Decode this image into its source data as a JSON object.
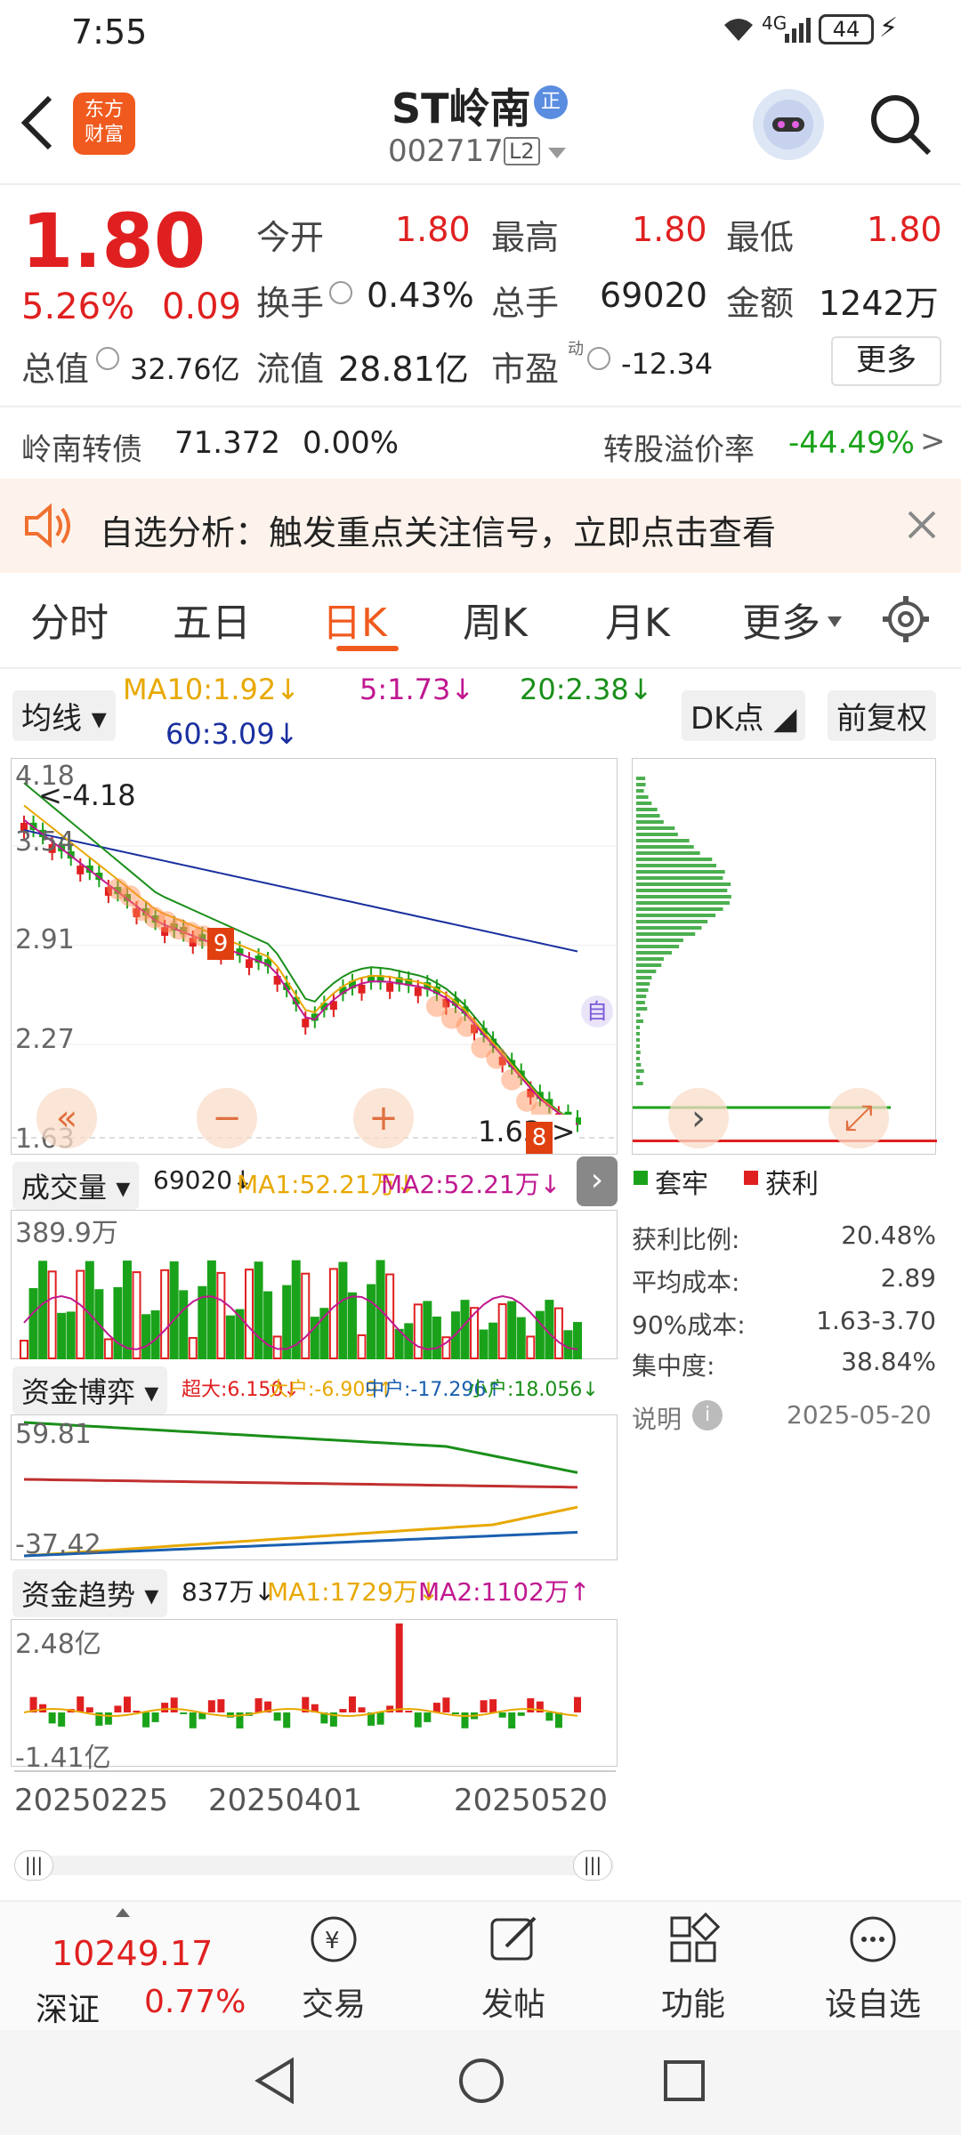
{
  "status": {
    "time": "7:55",
    "signal": "4G",
    "battery": "44"
  },
  "header": {
    "title": "ST岭南",
    "badge": "正",
    "code": "002717",
    "level": "L2",
    "logo_line1": "东方",
    "logo_line2": "财富"
  },
  "quote": {
    "price": "1.80",
    "pct": "5.26%",
    "chg": "0.09",
    "open_label": "今开",
    "open": "1.80",
    "high_label": "最高",
    "high": "1.80",
    "low_label": "最低",
    "low": "1.80",
    "turnover_label": "换手",
    "turnover": "0.43%",
    "vol_label": "总手",
    "vol": "69020",
    "amount_label": "金额",
    "amount": "1242万",
    "mcap_label": "总值",
    "mcap": "32.76亿",
    "float_label": "流值",
    "float": "28.81亿",
    "pe_label": "市盈",
    "pe_sup": "动",
    "pe": "-12.34",
    "more": "更多"
  },
  "bond": {
    "name": "岭南转债",
    "price": "71.372",
    "chg": "0.00%",
    "premium_label": "转股溢价率",
    "premium": "-44.49%",
    "arrow": ">"
  },
  "notice": {
    "text": "自选分析：触发重点关注信号，立即点击查看"
  },
  "tabs": [
    "分时",
    "五日",
    "日K",
    "周K",
    "月K",
    "更多"
  ],
  "ma": {
    "select": "均线",
    "ma10": "MA10:1.92↓",
    "ma5": "5:1.73↓",
    "ma20": "20:2.38↓",
    "ma60": "60:3.09↓",
    "dk": "DK点",
    "adjust": "前复权"
  },
  "kchart": {
    "y_top": "4.18",
    "high_marker": "<-4.18",
    "y2": "3.54",
    "y3": "2.91",
    "y4": "2.27",
    "y_bottom": "1.63",
    "low_marker": "1.63->",
    "self_tag": "自",
    "signal_9": "9",
    "signal_8": "8"
  },
  "chip": {
    "legend_trapped": "套牢",
    "legend_profit": "获利",
    "rows": [
      {
        "k": "获利比例:",
        "v": "20.48%"
      },
      {
        "k": "平均成本:",
        "v": "2.89"
      },
      {
        "k": "90%成本:",
        "v": "1.63-3.70"
      },
      {
        "k": "集中度:",
        "v": "38.84%"
      }
    ],
    "note": "说明",
    "date": "2025-05-20"
  },
  "volume": {
    "select": "成交量",
    "value": "69020↓",
    "ma1": "MA1:52.21万↓",
    "ma2": "MA2:52.21万↓",
    "top": "389.9万"
  },
  "fund": {
    "select": "资金博弈",
    "super": "超大:6.150↓",
    "large": "大户:-6.909↑",
    "mid": "中户:-17.296↑",
    "small": "小户:18.056↓",
    "top": "59.81",
    "bottom": "-37.42"
  },
  "trend": {
    "select": "资金趋势",
    "value": "837万↓",
    "ma1": "MA1:1729万↓",
    "ma2": "MA2:1102万↑",
    "top": "2.48亿",
    "bottom": "-1.41亿"
  },
  "dates": [
    "20250225",
    "20250401",
    "20250520"
  ],
  "index": {
    "value": "10249.17",
    "name": "深证",
    "pct": "0.77%"
  },
  "bottom_nav": [
    {
      "icon": "trade-icon",
      "label": "交易"
    },
    {
      "icon": "post-icon",
      "label": "发帖"
    },
    {
      "icon": "grid-icon",
      "label": "功能"
    },
    {
      "icon": "more-icon",
      "label": "设自选"
    }
  ],
  "colors": {
    "up": "#e02020",
    "down": "#1aa31a",
    "ma5": "#c01890",
    "ma10": "#e8a800",
    "ma20": "#1a8f1a",
    "ma60": "#1a2f9f",
    "signal": "#ff8a50"
  }
}
